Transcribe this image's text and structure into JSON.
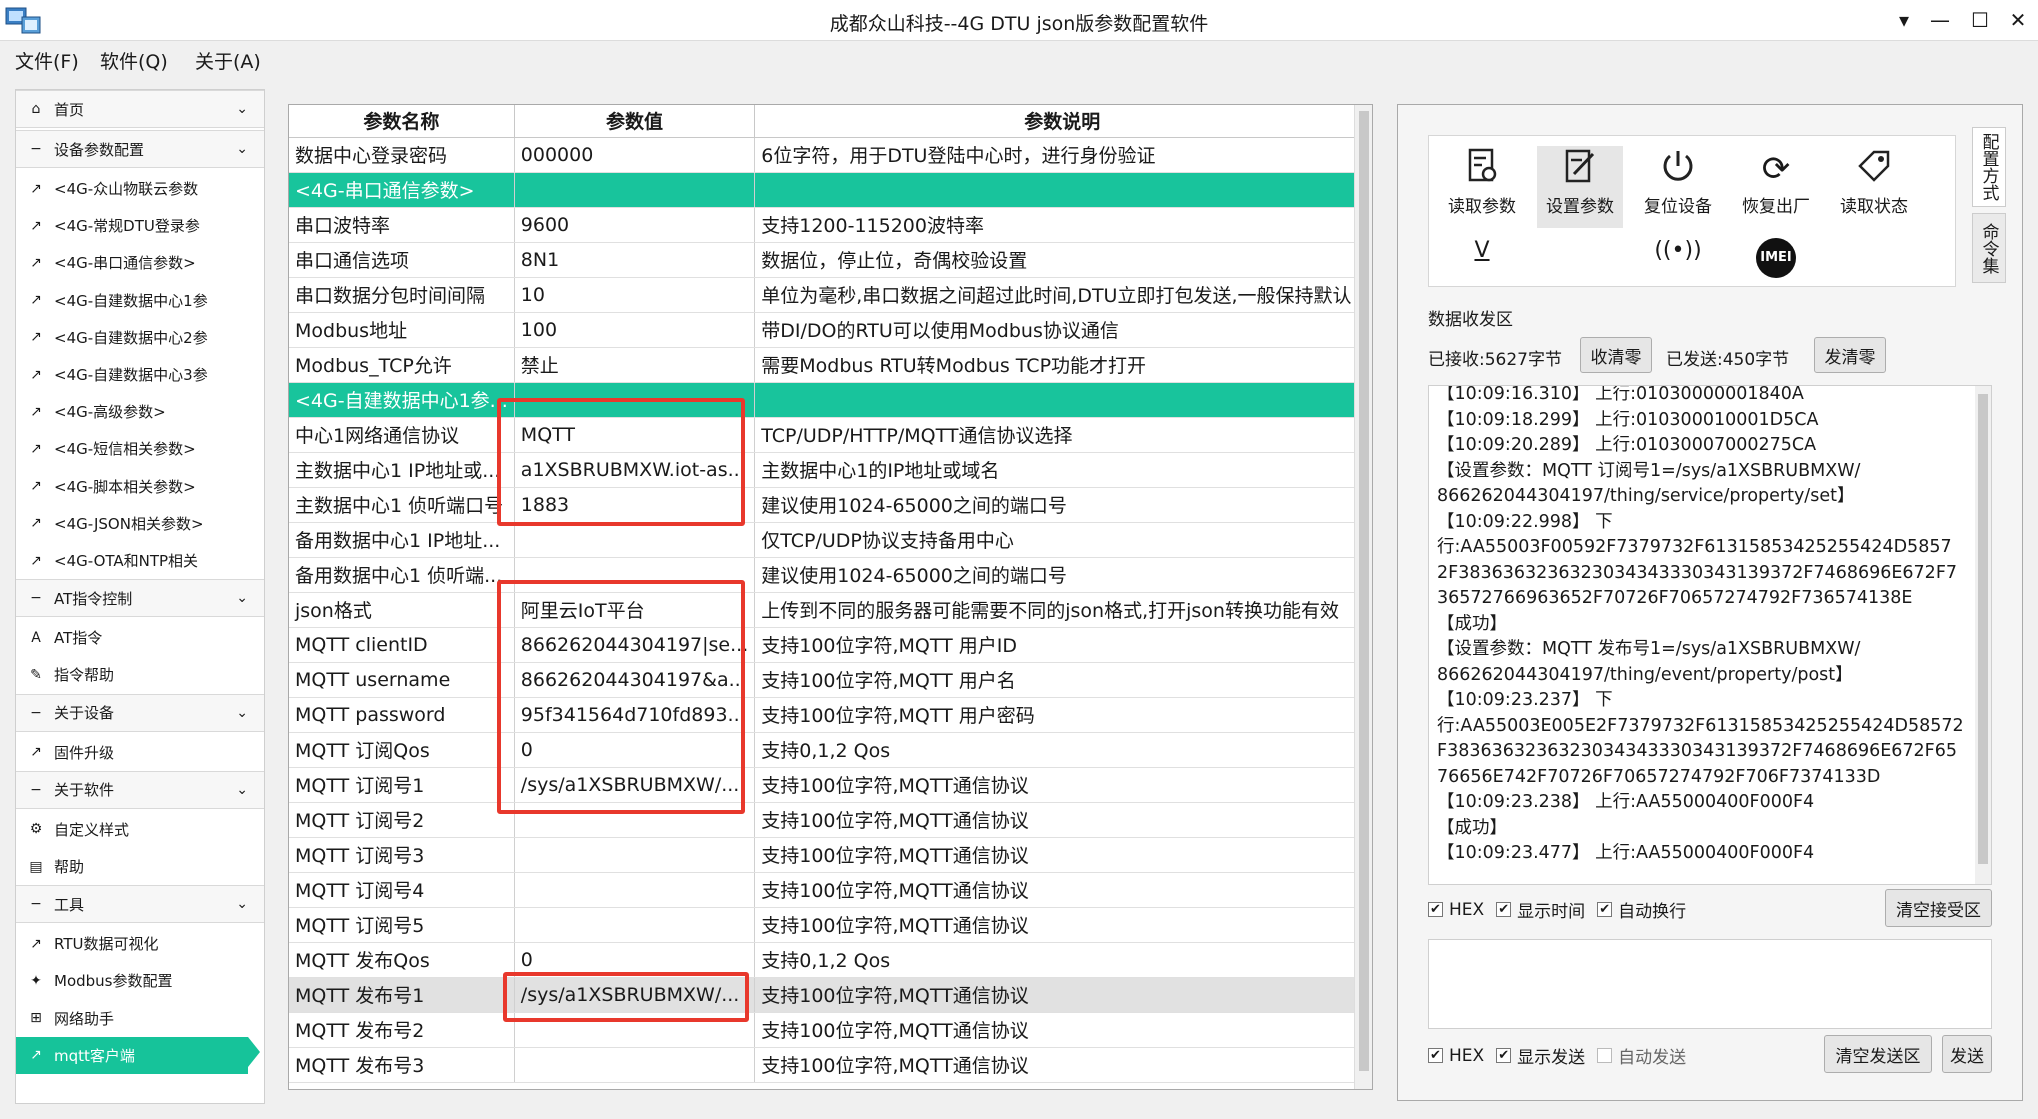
{
  "window": {
    "title": "成都众山科技--4G DTU json版参数配置软件"
  },
  "menu": [
    "文件(F)",
    "软件(Q)",
    "关于(A)"
  ],
  "sidebar": {
    "items": [
      {
        "label": "首页",
        "icon": "home-icon",
        "type": "header"
      },
      {
        "label": "设备参数配置",
        "icon": "minus-icon",
        "type": "header"
      },
      {
        "label": "<4G-众山物联云参数",
        "icon": "external-link-icon",
        "type": "item"
      },
      {
        "label": "<4G-常规DTU登录参",
        "icon": "external-link-icon",
        "type": "item"
      },
      {
        "label": "<4G-串口通信参数>",
        "icon": "external-link-icon",
        "type": "item"
      },
      {
        "label": "<4G-自建数据中心1参",
        "icon": "external-link-icon",
        "type": "item"
      },
      {
        "label": "<4G-自建数据中心2参",
        "icon": "external-link-icon",
        "type": "item"
      },
      {
        "label": "<4G-自建数据中心3参",
        "icon": "external-link-icon",
        "type": "item"
      },
      {
        "label": "<4G-高级参数>",
        "icon": "external-link-icon",
        "type": "item"
      },
      {
        "label": "<4G-短信相关参数>",
        "icon": "external-link-icon",
        "type": "item"
      },
      {
        "label": "<4G-脚本相关参数>",
        "icon": "external-link-icon",
        "type": "item"
      },
      {
        "label": "<4G-JSON相关参数>",
        "icon": "external-link-icon",
        "type": "item"
      },
      {
        "label": "<4G-OTA和NTP相关",
        "icon": "external-link-icon",
        "type": "item"
      },
      {
        "label": "AT指令控制",
        "icon": "minus-icon",
        "type": "header"
      },
      {
        "label": "AT指令",
        "icon": "text-a-icon",
        "type": "item"
      },
      {
        "label": "指令帮助",
        "icon": "edit-icon",
        "type": "item"
      },
      {
        "label": "关于设备",
        "icon": "minus-icon",
        "type": "header"
      },
      {
        "label": "固件升级",
        "icon": "external-link-icon",
        "type": "item"
      },
      {
        "label": "关于软件",
        "icon": "minus-icon",
        "type": "header"
      },
      {
        "label": "自定义样式",
        "icon": "settings-icon",
        "type": "item"
      },
      {
        "label": "帮助",
        "icon": "document-icon",
        "type": "item"
      },
      {
        "label": "工具",
        "icon": "minus-icon",
        "type": "header"
      },
      {
        "label": "RTU数据可视化",
        "icon": "external-link-icon",
        "type": "item"
      },
      {
        "label": "Modbus参数配置",
        "icon": "wrench-icon",
        "type": "item"
      },
      {
        "label": "网络助手",
        "icon": "network-icon",
        "type": "item"
      },
      {
        "label": "mqtt客户端",
        "icon": "external-link-icon",
        "type": "item",
        "selected": true
      }
    ]
  },
  "table": {
    "headers": [
      "参数名称",
      "参数值",
      "参数说明"
    ],
    "rows": [
      {
        "name": "数据中心登录密码",
        "value": "000000",
        "desc": "6位字符，用于DTU登陆中心时，进行身份验证"
      },
      {
        "name": "<4G-串口通信参数>",
        "value": "",
        "desc": "",
        "kind": "section"
      },
      {
        "name": "串口波特率",
        "value": "9600",
        "desc": "支持1200-115200波特率"
      },
      {
        "name": "串口通信选项",
        "value": "8N1",
        "desc": "数据位，停止位，奇偶校验设置"
      },
      {
        "name": "串口数据分包时间间隔",
        "value": "10",
        "desc": "单位为毫秒,串口数据之间超过此时间,DTU立即打包发送,一般保持默认"
      },
      {
        "name": "Modbus地址",
        "value": "100",
        "desc": "带DI/DO的RTU可以使用Modbus协议通信"
      },
      {
        "name": "Modbus_TCP允许",
        "value": "禁止",
        "desc": "需要Modbus RTU转Modbus TCP功能才打开"
      },
      {
        "name": "<4G-自建数据中心1参...",
        "value": "",
        "desc": "",
        "kind": "section"
      },
      {
        "name": "中心1网络通信协议",
        "value": "MQTT",
        "desc": "TCP/UDP/HTTP/MQTT通信协议选择"
      },
      {
        "name": "主数据中心1 IP地址或...",
        "value": "a1XSBRUBMXW.iot-as...",
        "desc": "主数据中心1的IP地址或域名"
      },
      {
        "name": "主数据中心1 侦听端口号",
        "value": "1883",
        "desc": "建议使用1024-65000之间的端口号"
      },
      {
        "name": "备用数据中心1 IP地址...",
        "value": "",
        "desc": "仅TCP/UDP协议支持备用中心"
      },
      {
        "name": "备用数据中心1 侦听端...",
        "value": "",
        "desc": "建议使用1024-65000之间的端口号"
      },
      {
        "name": "json格式",
        "value": "阿里云IoT平台",
        "desc": "上传到不同的服务器可能需要不同的json格式,打开json转换功能有效"
      },
      {
        "name": "MQTT clientID",
        "value": "866262044304197|se...",
        "desc": "支持100位字符,MQTT 用户ID"
      },
      {
        "name": "MQTT username",
        "value": "866262044304197&a...",
        "desc": "支持100位字符,MQTT 用户名"
      },
      {
        "name": "MQTT password",
        "value": "95f341564d710fd893...",
        "desc": "支持100位字符,MQTT 用户密码"
      },
      {
        "name": "MQTT 订阅Qos",
        "value": "0",
        "desc": "支持0,1,2 Qos"
      },
      {
        "name": "MQTT 订阅号1",
        "value": "/sys/a1XSBRUBMXW/...",
        "desc": "支持100位字符,MQTT通信协议"
      },
      {
        "name": "MQTT 订阅号2",
        "value": "",
        "desc": "支持100位字符,MQTT通信协议"
      },
      {
        "name": "MQTT 订阅号3",
        "value": "",
        "desc": "支持100位字符,MQTT通信协议"
      },
      {
        "name": "MQTT 订阅号4",
        "value": "",
        "desc": "支持100位字符,MQTT通信协议"
      },
      {
        "name": "MQTT 订阅号5",
        "value": "",
        "desc": "支持100位字符,MQTT通信协议"
      },
      {
        "name": "MQTT 发布Qos",
        "value": "0",
        "desc": "支持0,1,2 Qos"
      },
      {
        "name": "MQTT 发布号1",
        "value": "/sys/a1XSBRUBMXW/...",
        "desc": "支持100位字符,MQTT通信协议",
        "kind": "hl"
      },
      {
        "name": "MQTT 发布号2",
        "value": "",
        "desc": "支持100位字符,MQTT通信协议"
      },
      {
        "name": "MQTT 发布号3",
        "value": "",
        "desc": "支持100位字符,MQTT通信协议"
      }
    ]
  },
  "toolbar": {
    "buttons": [
      {
        "label": "读取参数",
        "icon": "read-params-icon"
      },
      {
        "label": "设置参数",
        "icon": "set-params-icon",
        "active": true
      },
      {
        "label": "复位设备",
        "icon": "power-reset-icon"
      },
      {
        "label": "恢复出厂",
        "icon": "refresh-icon"
      },
      {
        "label": "读取状态",
        "icon": "tag-icon"
      }
    ],
    "second_row": [
      {
        "label": "V",
        "icon": "version-icon"
      },
      {
        "label": "",
        "icon": "signal-icon"
      },
      {
        "label": "IMEI",
        "icon": "imei-icon"
      }
    ],
    "side_tabs": [
      "配置方式",
      "命令集"
    ]
  },
  "comm": {
    "title": "数据收发区",
    "received": "已接收:5627字节",
    "clear_recv": "收清零",
    "sent": "已发送:450字节",
    "clear_sent": "发清零",
    "log": [
      "【10:09:16.310】 上行:01030000001840A",
      "【10:09:18.299】 上行:010300010001D5CA",
      "【10:09:20.289】 上行:01030007000275CA",
      "【设置参数：MQTT 订阅号1=/sys/a1XSBRUBMXW/",
      "866262044304197/thing/service/property/set】",
      "【10:09:22.998】 下",
      "行:AA55003F00592F7379732F61315853425255424D5857",
      "2F38363632363230343433303431393​72F7468696E672F7",
      "36572766963652F70726F70657274792F736574138E",
      "【成功】",
      "【设置参数：MQTT 发布号1=/sys/a1XSBRUBMXW/",
      "866262044304197/thing/event/property/post】",
      "【10:09:23.237】 下",
      "行:AA55003E005E2F7379732F61315853425255424D58572",
      "F38363632363230343433303431393​72F7468696E672F65",
      "76656E742F70726F70657274792F706F7374133D",
      "【10:09:23.238】 上行:AA55000400F000F4",
      "【成功】",
      "【10:09:23.477】 上行:AA55000400F000F4"
    ],
    "recv_options": {
      "hex": "HEX",
      "show_time": "显示时间",
      "auto_wrap": "自动换行"
    },
    "clear_recv_area": "清空接受区",
    "send_options": {
      "hex": "HEX",
      "show_send": "显示发送",
      "auto_send": "自动发送"
    },
    "clear_send_area": "清空发送区",
    "send": "发送"
  }
}
